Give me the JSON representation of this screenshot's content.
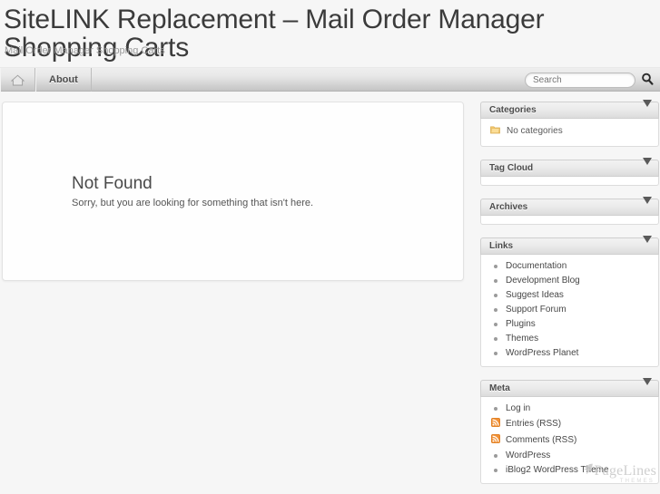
{
  "header": {
    "site_title": "SiteLINK Replacement – Mail Order Manager Shopping Carts",
    "tagline": "Mail Order Manager Shopping Carts"
  },
  "nav": {
    "home_icon": "home-icon",
    "items": [
      {
        "label": "About"
      }
    ],
    "search": {
      "placeholder": "Search",
      "value": "",
      "button_icon": "search-icon"
    }
  },
  "main": {
    "not_found_title": "Not Found",
    "not_found_text": "Sorry, but you are looking for something that isn't here."
  },
  "sidebar": {
    "widgets": [
      {
        "title": "Categories",
        "toggle_icon": "chevron-down-icon",
        "type": "categories",
        "empty_label": "No categories",
        "item_icon": "folder-icon"
      },
      {
        "title": "Tag Cloud",
        "toggle_icon": "chevron-down-icon",
        "type": "empty"
      },
      {
        "title": "Archives",
        "toggle_icon": "chevron-down-icon",
        "type": "empty"
      },
      {
        "title": "Links",
        "toggle_icon": "chevron-down-icon",
        "type": "list",
        "items": [
          {
            "label": "Documentation",
            "icon": "bullet-icon"
          },
          {
            "label": "Development Blog",
            "icon": "bullet-icon"
          },
          {
            "label": "Suggest Ideas",
            "icon": "bullet-icon"
          },
          {
            "label": "Support Forum",
            "icon": "bullet-icon"
          },
          {
            "label": "Plugins",
            "icon": "bullet-icon"
          },
          {
            "label": "Themes",
            "icon": "bullet-icon"
          },
          {
            "label": "WordPress Planet",
            "icon": "bullet-icon"
          }
        ]
      },
      {
        "title": "Meta",
        "toggle_icon": "chevron-down-icon",
        "type": "list",
        "items": [
          {
            "label": "Log in",
            "icon": "bullet-icon"
          },
          {
            "label": "Entries (RSS)",
            "icon": "rss-icon"
          },
          {
            "label": "Comments (RSS)",
            "icon": "rss-icon"
          },
          {
            "label": "WordPress",
            "icon": "bullet-icon"
          },
          {
            "label": "iBlog2 WordPress Theme",
            "icon": "bullet-icon"
          }
        ]
      }
    ]
  },
  "footer": {
    "logo_name": "PageLines",
    "logo_sub": "THEMES"
  },
  "colors": {
    "page_bg": "#f6f6f6",
    "panel_bg": "#fefefe",
    "text": "#474747",
    "rss_orange": "#f19035",
    "folder_yellow": "#f5c96a"
  }
}
